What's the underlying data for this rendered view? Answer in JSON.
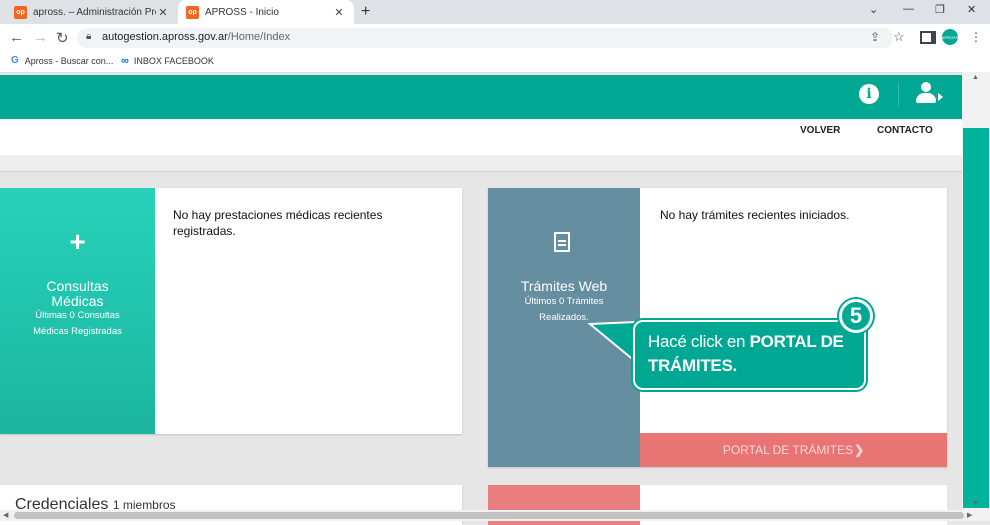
{
  "browser": {
    "tabs": [
      {
        "title": "apross. – Administración Provincial",
        "favicon": "op"
      },
      {
        "title": "APROSS - Inicio",
        "favicon": "op"
      }
    ],
    "url_host": "autogestion.apross.gov.ar",
    "url_path": "/Home/Index",
    "bookmarks": [
      {
        "label": "Apross - Buscar con...",
        "icon": "google-icon"
      },
      {
        "label": "INBOX FACEBOOK",
        "icon": "meta-icon"
      }
    ],
    "profile_label": "APROSS"
  },
  "header": {
    "nav": [
      "VOLVER",
      "CONTACTO"
    ]
  },
  "consultas": {
    "title": "Consultas Médicas",
    "subtitle": "Últimas 0 Consultas Médicas Registradas",
    "message": "No hay prestaciones médicas recientes registradas."
  },
  "tramites": {
    "title": "Trámites Web",
    "subtitle": "Últimos 0 Trámites Realizados.",
    "message": "No hay trámites recientes iniciados.",
    "button": "PORTAL DE TRÁMITES"
  },
  "credenciales": {
    "title": "Credenciales",
    "count": "1 miembros"
  },
  "callout": {
    "step": "5",
    "text_plain": "Hacé click en",
    "text_bold": "PORTAL DE TRÁMITES."
  },
  "colors": {
    "brand": "#00a894",
    "consultas": "#22c8b0",
    "tramites": "#658fa0",
    "portal_button": "#e87474"
  }
}
